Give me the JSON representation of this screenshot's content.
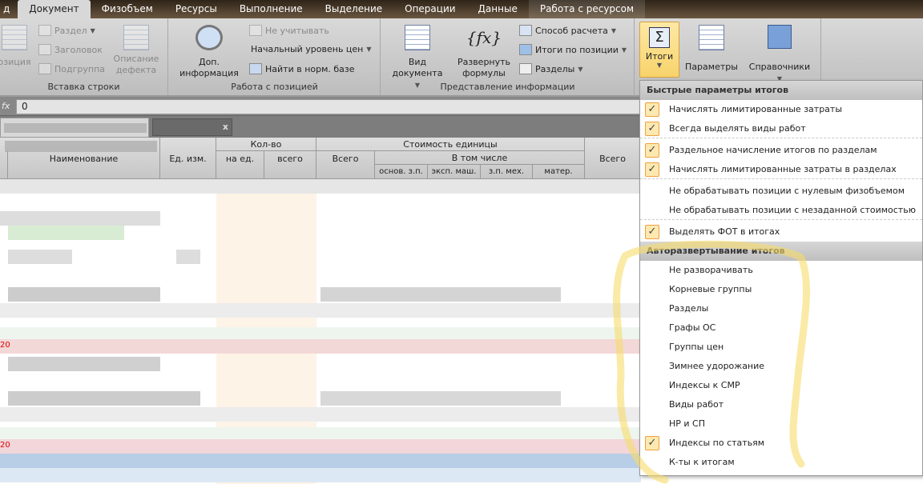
{
  "tabs": [
    "д",
    "Документ",
    "Физобъем",
    "Ресурсы",
    "Выполнение",
    "Выделение",
    "Операции",
    "Данные",
    "Работа с ресурсом"
  ],
  "ribbon": {
    "insert_row": {
      "position": "озиция",
      "section": "Раздел",
      "header": "Заголовок",
      "subgroup": "Подгруппа",
      "defect_1": "Описание",
      "defect_2": "дефекта",
      "label": "Вставка строки"
    },
    "position_work": {
      "info_1": "Доп.",
      "info_2": "информация",
      "ignore": "Не учитывать",
      "price_level": "Начальный уровень цен",
      "find": "Найти в норм. базе",
      "label": "Работа с позицией"
    },
    "info_view": {
      "view_1": "Вид",
      "view_2": "документа",
      "expand_1": "Развернуть",
      "expand_2": "формулы",
      "calc": "Способ расчета",
      "totals_pos": "Итоги по позиции",
      "sections": "Разделы",
      "label": "Представление информации"
    },
    "itogi": "Итоги",
    "params": "Параметры",
    "refs": "Справочники"
  },
  "formula": {
    "value": "0"
  },
  "doc_tab_close": "x",
  "table_header": {
    "qty": "Кол-во",
    "unit_cost": "Стоимость единицы",
    "name": "Наименование",
    "unit": "Ед. изм.",
    "per_unit": "на ед.",
    "total": "всего",
    "all": "Всего",
    "incl": "В том числе",
    "base_wage": "основ. з.п.",
    "machines": "эксп. маш.",
    "mech_wage": "з.п. мех.",
    "materials": "матер.",
    "all2": "Всего"
  },
  "menu": {
    "section1": "Быстрые параметры итогов",
    "items1": [
      {
        "label": "Начислять лимитированные затраты",
        "checked": true
      },
      {
        "label": "Всегда выделять виды работ",
        "checked": true
      },
      {
        "label": "Раздельное начисление итогов по разделам",
        "checked": true
      },
      {
        "label": "Начислять лимитированные затраты в разделах",
        "checked": true
      },
      {
        "label": "Не обрабатывать позиции с нулевым физобъемом",
        "checked": false
      },
      {
        "label": "Не обрабатывать позиции с незаданной стоимостью",
        "checked": false
      },
      {
        "label": "Выделять ФОТ в итогах",
        "checked": true
      }
    ],
    "section2": "Авторазвертывание итогов",
    "items2": [
      {
        "label": "Не разворачивать",
        "checked": false
      },
      {
        "label": "Корневые группы",
        "checked": false
      },
      {
        "label": "Разделы",
        "checked": false
      },
      {
        "label": "Графы ОС",
        "checked": false
      },
      {
        "label": "Группы цен",
        "checked": false
      },
      {
        "label": "Зимнее удорожание",
        "checked": false
      },
      {
        "label": "Индексы к СМР",
        "checked": false
      },
      {
        "label": "Виды работ",
        "checked": false
      },
      {
        "label": "НР и СП",
        "checked": false
      },
      {
        "label": "Индексы по статьям",
        "checked": true
      },
      {
        "label": "К-ты к итогам",
        "checked": false
      }
    ]
  },
  "row_markers": [
    "20",
    "20"
  ],
  "check_glyph": "✓"
}
